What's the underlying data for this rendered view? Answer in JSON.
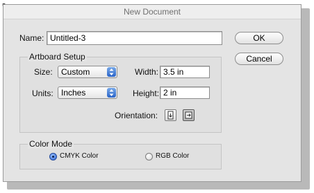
{
  "window": {
    "title": "New Document",
    "corner_glyph": "↖"
  },
  "name": {
    "label": "Name:",
    "value": "Untitled-3"
  },
  "buttons": {
    "ok": "OK",
    "cancel": "Cancel"
  },
  "artboard": {
    "title": "Artboard Setup",
    "size_label": "Size:",
    "size_value": "Custom",
    "units_label": "Units:",
    "units_value": "Inches",
    "width_label": "Width:",
    "width_value": "3.5 in",
    "height_label": "Height:",
    "height_value": "2 in",
    "orientation_label": "Orientation:",
    "orientation_selected": "landscape"
  },
  "color_mode": {
    "title": "Color Mode",
    "options": [
      {
        "label": "CMYK Color",
        "selected": true
      },
      {
        "label": "RGB Color",
        "selected": false
      }
    ]
  },
  "icons": [
    "stepper-icon",
    "portrait-icon",
    "landscape-icon",
    "radio-icon",
    "corner-icon"
  ]
}
